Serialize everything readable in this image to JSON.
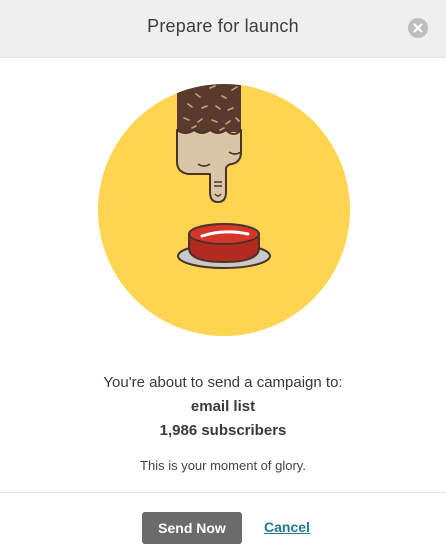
{
  "dialog": {
    "title": "Prepare for launch",
    "close_icon": "close-icon"
  },
  "illustration": {
    "icon": "finger-pressing-red-button-illustration",
    "colors": {
      "circle": "#ffd451",
      "button_red": "#d8352a",
      "plate": "#c9c9c9",
      "skin": "#d9c6a8",
      "sleeve": "#5a3a2e"
    }
  },
  "body": {
    "message": "You're about to send a campaign to:",
    "list_name": "email list",
    "subscribers": "1,986 subscribers",
    "tagline": "This is your moment of glory."
  },
  "footer": {
    "send_label": "Send Now",
    "cancel_label": "Cancel"
  }
}
